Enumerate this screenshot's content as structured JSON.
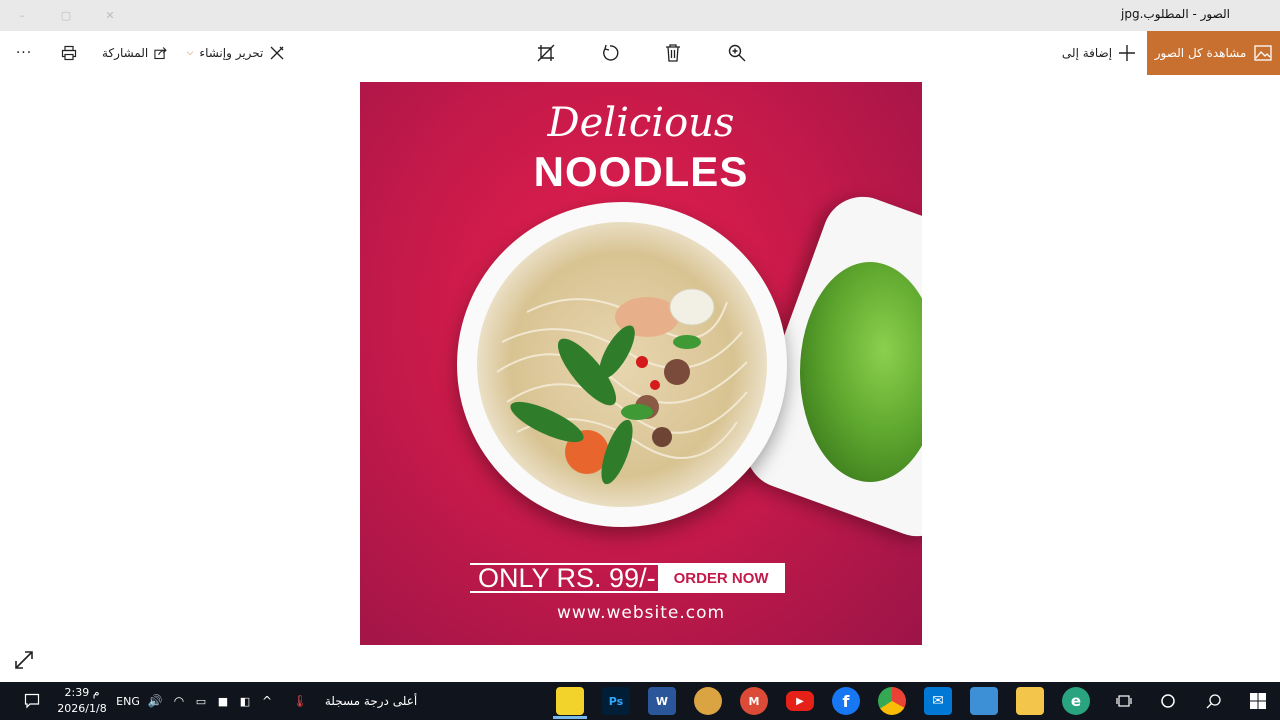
{
  "window": {
    "title": "الصور - المطلوب.jpg",
    "controls": [
      "–",
      "▢",
      "✕"
    ]
  },
  "toolbar": {
    "view_all": "مشاهدة كل الصور",
    "add_to": "إضافة إلى",
    "edit_create": "تحرير وإنشاء",
    "share": "المشاركة",
    "more": "···",
    "icons": [
      "image-icon",
      "plus-icon",
      "zoom-icon",
      "delete-icon",
      "rotate-icon",
      "crop-icon",
      "edit-icon",
      "share-icon",
      "print-icon",
      "more-icon"
    ]
  },
  "poster": {
    "script_title": "Delicious",
    "headline": "NOODLES",
    "price": "ONLY RS. 99/-",
    "cta": "ORDER NOW",
    "website": "www.website.com",
    "colors": {
      "bg_center": "#e4204e",
      "bg_edge": "#9c1448",
      "cta_text": "#c41a4a"
    }
  },
  "taskbar": {
    "time": "2:39 م",
    "date": "2026/1/8",
    "language": "ENG",
    "weather": "أعلى درجة مسجلة",
    "apps": [
      {
        "name": "photos",
        "label": ""
      },
      {
        "name": "photoshop",
        "label": "Ps"
      },
      {
        "name": "word",
        "label": "W"
      },
      {
        "name": "chrome-profile-1",
        "label": ""
      },
      {
        "name": "chrome-profile-2",
        "label": "M"
      },
      {
        "name": "youtube",
        "label": "▶"
      },
      {
        "name": "facebook",
        "label": "f"
      },
      {
        "name": "chrome",
        "label": ""
      },
      {
        "name": "mail",
        "label": "✉"
      },
      {
        "name": "store",
        "label": ""
      },
      {
        "name": "file-explorer",
        "label": ""
      },
      {
        "name": "edge",
        "label": "e"
      }
    ]
  }
}
